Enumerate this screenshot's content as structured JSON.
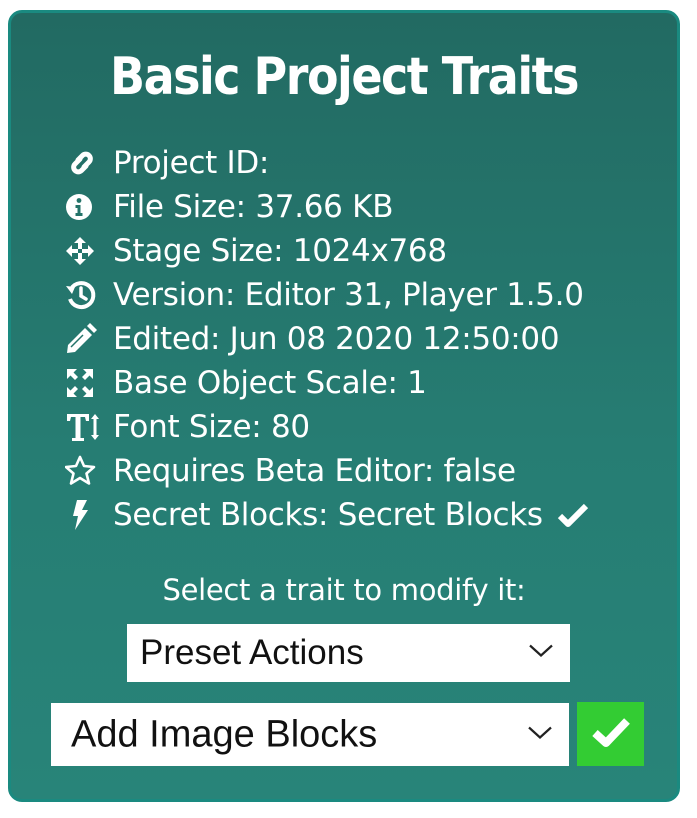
{
  "panel": {
    "title": "Basic Project Traits",
    "traits": [
      {
        "icon": "link-icon",
        "label": "Project ID:"
      },
      {
        "icon": "info-icon",
        "label": "File Size: 37.66 KB"
      },
      {
        "icon": "move-arrows-icon",
        "label": "Stage Size: 1024x768"
      },
      {
        "icon": "history-icon",
        "label": "Version: Editor 31, Player 1.5.0"
      },
      {
        "icon": "pencil-icon",
        "label": "Edited: Jun 08 2020 12:50:00"
      },
      {
        "icon": "expand-icon",
        "label": "Base Object Scale: 1"
      },
      {
        "icon": "text-height-icon",
        "label": "Font Size: 80"
      },
      {
        "icon": "star-outline-icon",
        "label": "Requires Beta Editor: false"
      },
      {
        "icon": "bolt-icon",
        "label": "Secret Blocks: Secret Blocks",
        "status_icon": "check-icon"
      }
    ],
    "prompt": "Select a trait to modify it:",
    "trait_select": {
      "value": "Preset Actions"
    },
    "action_select": {
      "value": "Add Image Blocks"
    },
    "confirm_icon": "check-icon"
  },
  "colors": {
    "panel_top": "#226a62",
    "panel_bottom": "#288479",
    "panel_border": "#1a8a80",
    "confirm_button": "#33cc33",
    "text": "#ffffff"
  }
}
